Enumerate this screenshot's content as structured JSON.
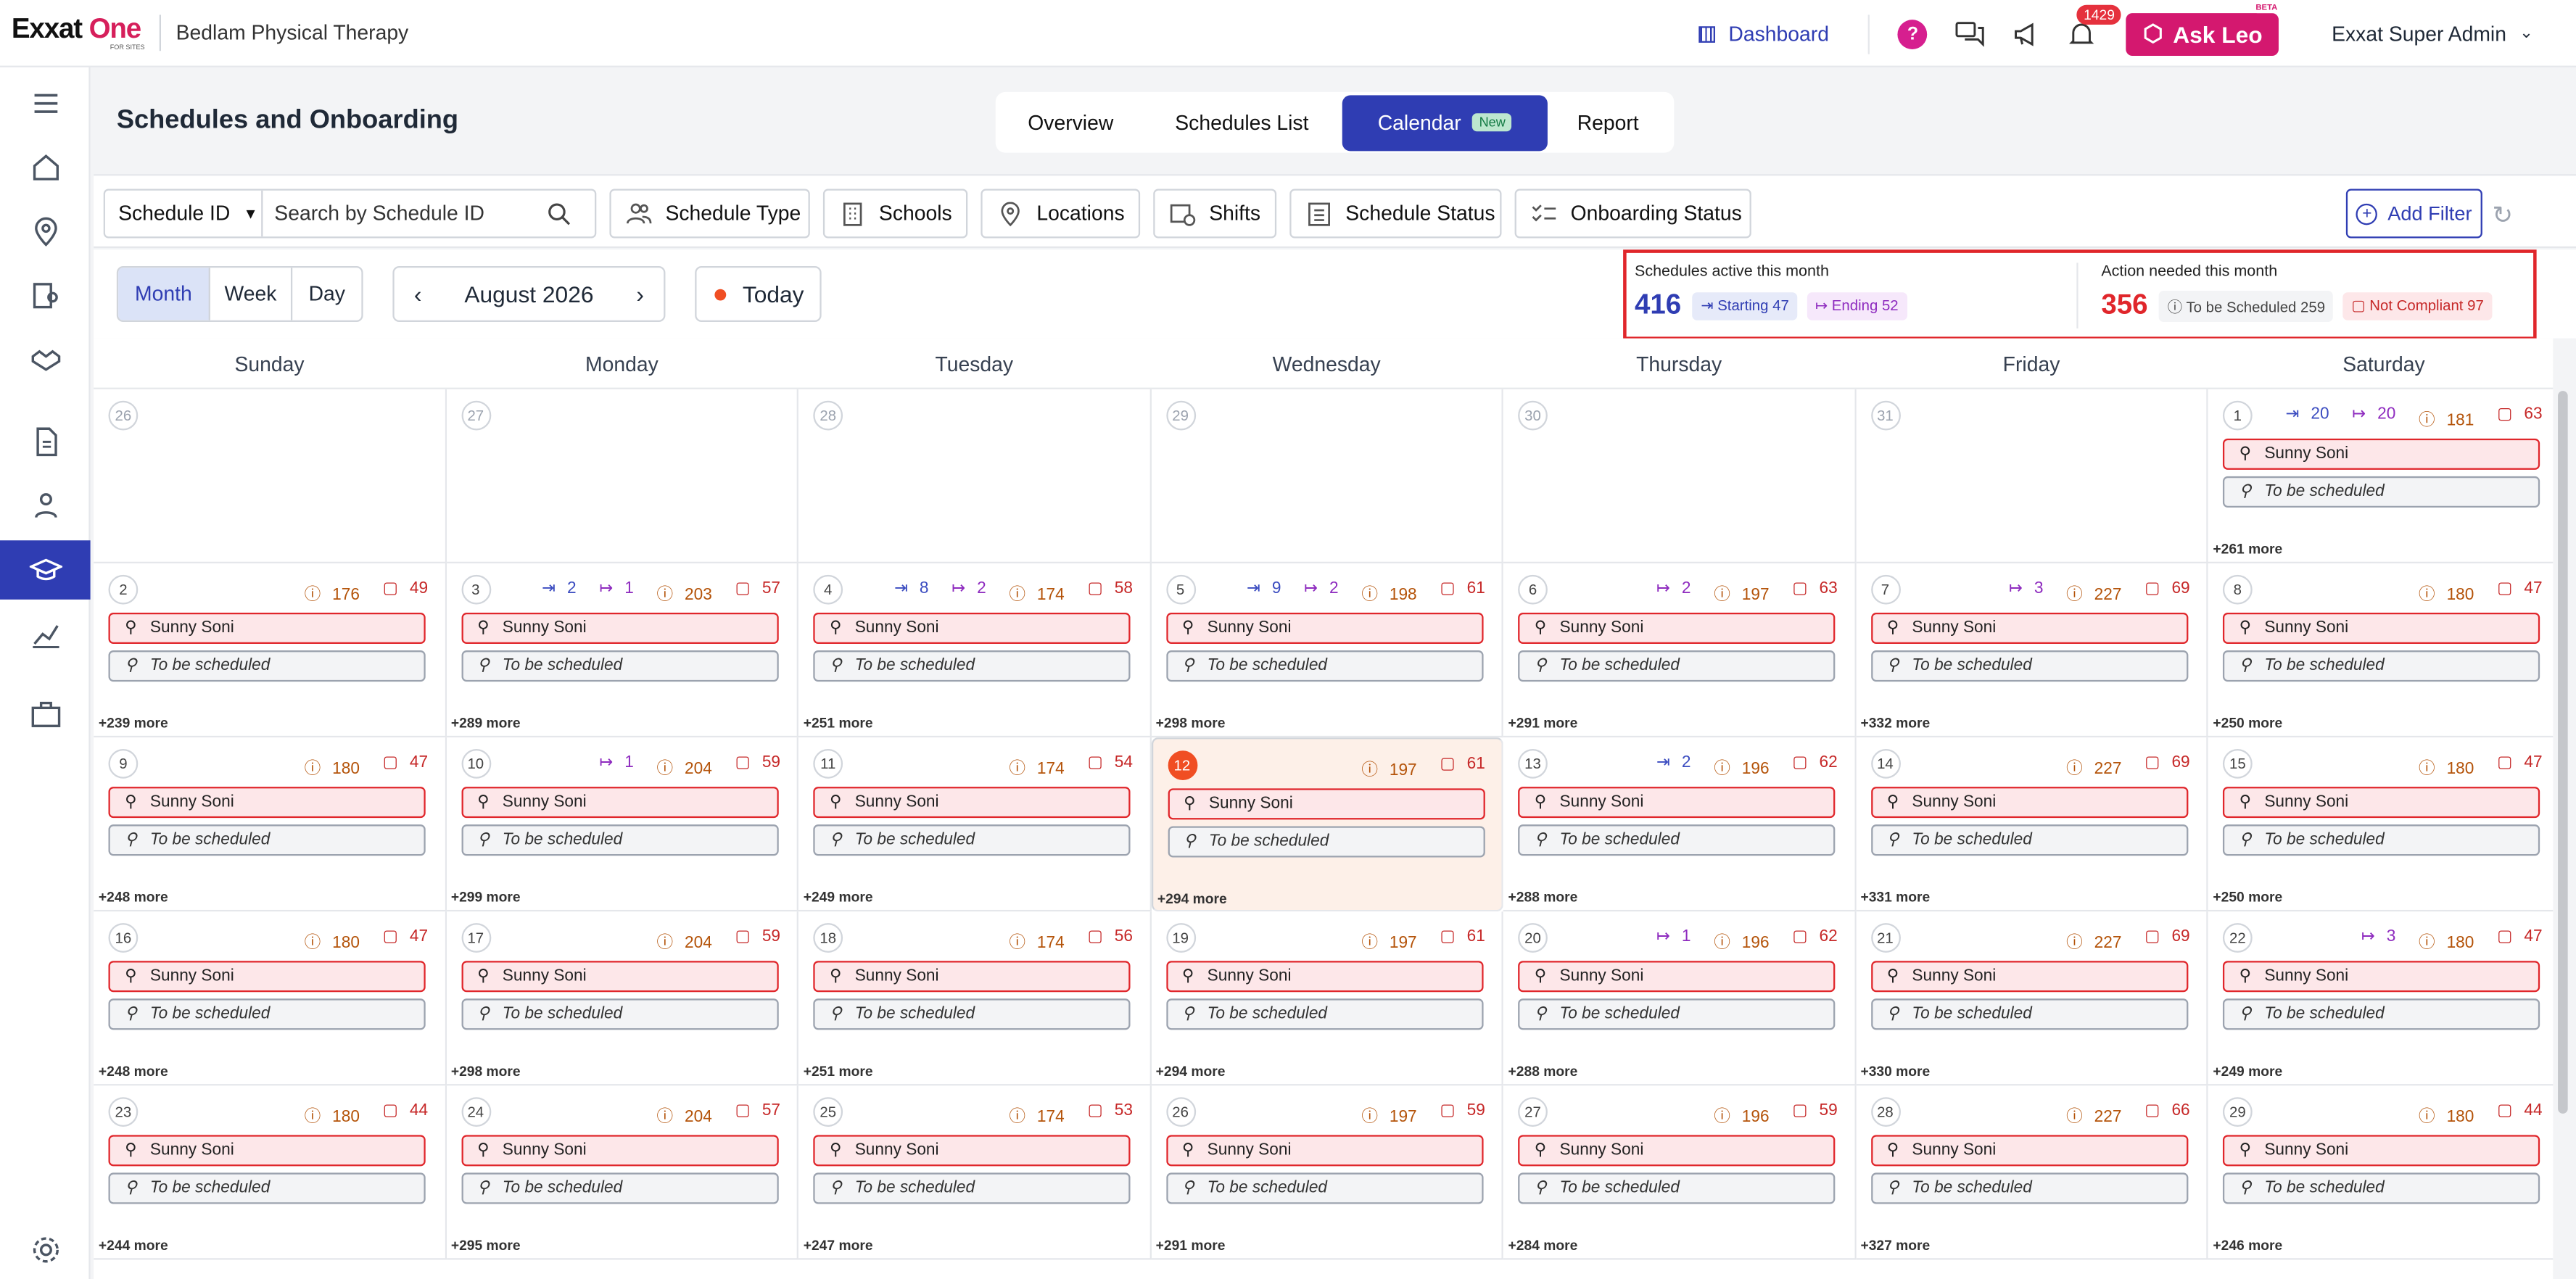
{
  "app": {
    "logo_main": "Exxat",
    "logo_accent": "One",
    "logo_sub": "FOR SITES",
    "org": "Bedlam Physical Therapy"
  },
  "topbar": {
    "dashboard": "Dashboard",
    "help": "?",
    "notifications_count": "1429",
    "ask_leo": "Ask Leo",
    "beta": "BETA",
    "user": "Exxat Super Admin"
  },
  "page": {
    "title": "Schedules and Onboarding"
  },
  "tabs": [
    {
      "label": "Overview"
    },
    {
      "label": "Schedules List"
    },
    {
      "label": "Calendar",
      "badge": "New"
    },
    {
      "label": "Report"
    }
  ],
  "filters": {
    "search_by": "Schedule ID",
    "search_placeholder": "Search by Schedule ID",
    "schedule_type": "Schedule Type",
    "schools": "Schools",
    "locations": "Locations",
    "shifts": "Shifts",
    "schedule_status": "Schedule Status",
    "onboarding_status": "Onboarding Status",
    "add_filter": "Add Filter"
  },
  "view": {
    "month": "Month",
    "week": "Week",
    "day": "Day",
    "current_month": "August 2026",
    "today": "Today"
  },
  "stats": {
    "active_label": "Schedules active this month",
    "active_value": "416",
    "starting": "Starting 47",
    "ending": "Ending 52",
    "action_label": "Action needed this month",
    "action_value": "356",
    "to_be_scheduled": "To be Scheduled 259",
    "not_compliant": "Not Compliant 97"
  },
  "weekdays": [
    "Sunday",
    "Monday",
    "Tuesday",
    "Wednesday",
    "Thursday",
    "Friday",
    "Saturday"
  ],
  "event": {
    "name": "Sunny Soni",
    "pending": "To be scheduled"
  },
  "weeks": [
    [
      {
        "d": "26",
        "out": true
      },
      {
        "d": "27",
        "out": true
      },
      {
        "d": "28",
        "out": true
      },
      {
        "d": "29",
        "out": true
      },
      {
        "d": "30",
        "out": true
      },
      {
        "d": "31",
        "out": true
      },
      {
        "d": "1",
        "s": "20",
        "e": "20",
        "q": "181",
        "n": "63",
        "more": "+261 more"
      }
    ],
    [
      {
        "d": "2",
        "q": "176",
        "n": "49",
        "more": "+239 more"
      },
      {
        "d": "3",
        "s": "2",
        "e": "1",
        "q": "203",
        "n": "57",
        "more": "+289 more"
      },
      {
        "d": "4",
        "s": "8",
        "e": "2",
        "q": "174",
        "n": "58",
        "more": "+251 more"
      },
      {
        "d": "5",
        "s": "9",
        "e": "2",
        "q": "198",
        "n": "61",
        "more": "+298 more"
      },
      {
        "d": "6",
        "e": "2",
        "q": "197",
        "n": "63",
        "more": "+291 more"
      },
      {
        "d": "7",
        "e": "3",
        "q": "227",
        "n": "69",
        "more": "+332 more"
      },
      {
        "d": "8",
        "q": "180",
        "n": "47",
        "more": "+250 more"
      }
    ],
    [
      {
        "d": "9",
        "q": "180",
        "n": "47",
        "more": "+248 more"
      },
      {
        "d": "10",
        "e": "1",
        "q": "204",
        "n": "59",
        "more": "+299 more"
      },
      {
        "d": "11",
        "q": "174",
        "n": "54",
        "more": "+249 more"
      },
      {
        "d": "12",
        "today": true,
        "q": "197",
        "n": "61",
        "more": "+294 more"
      },
      {
        "d": "13",
        "s": "2",
        "q": "196",
        "n": "62",
        "more": "+288 more"
      },
      {
        "d": "14",
        "q": "227",
        "n": "69",
        "more": "+331 more"
      },
      {
        "d": "15",
        "q": "180",
        "n": "47",
        "more": "+250 more"
      }
    ],
    [
      {
        "d": "16",
        "q": "180",
        "n": "47",
        "more": "+248 more"
      },
      {
        "d": "17",
        "q": "204",
        "n": "59",
        "more": "+298 more"
      },
      {
        "d": "18",
        "q": "174",
        "n": "56",
        "more": "+251 more"
      },
      {
        "d": "19",
        "q": "197",
        "n": "61",
        "more": "+294 more"
      },
      {
        "d": "20",
        "e": "1",
        "q": "196",
        "n": "62",
        "more": "+288 more"
      },
      {
        "d": "21",
        "q": "227",
        "n": "69",
        "more": "+330 more"
      },
      {
        "d": "22",
        "e": "3",
        "q": "180",
        "n": "47",
        "more": "+249 more"
      }
    ],
    [
      {
        "d": "23",
        "q": "180",
        "n": "44",
        "more": "+244 more"
      },
      {
        "d": "24",
        "q": "204",
        "n": "57",
        "more": "+295 more"
      },
      {
        "d": "25",
        "q": "174",
        "n": "53",
        "more": "+247 more"
      },
      {
        "d": "26",
        "q": "197",
        "n": "59",
        "more": "+291 more"
      },
      {
        "d": "27",
        "q": "196",
        "n": "59",
        "more": "+284 more"
      },
      {
        "d": "28",
        "q": "227",
        "n": "66",
        "more": "+327 more"
      },
      {
        "d": "29",
        "q": "180",
        "n": "44",
        "more": "+246 more"
      }
    ]
  ],
  "colors": {
    "primary": "#2f3db3",
    "brand_pink": "#d4186f",
    "alert": "#e0262b",
    "today": "#f04e23"
  }
}
